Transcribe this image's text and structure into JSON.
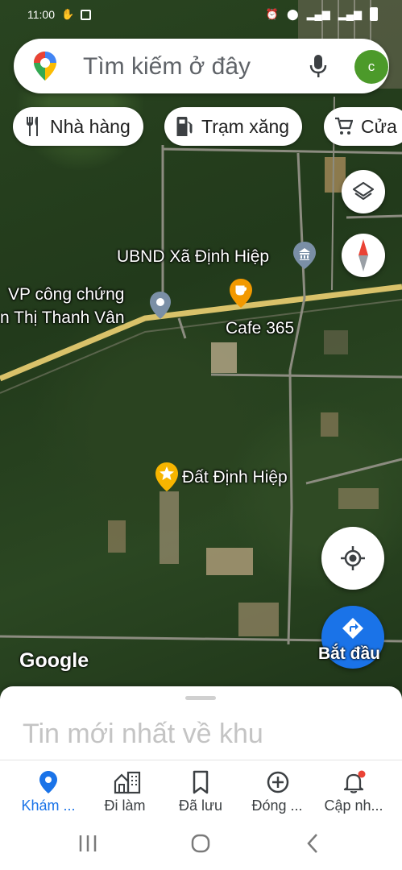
{
  "status_bar": {
    "time": "11:00"
  },
  "search": {
    "placeholder": "Tìm kiếm ở đây",
    "avatar_letter": "c"
  },
  "chips": [
    {
      "label": "Nhà hàng",
      "icon": "restaurant-icon"
    },
    {
      "label": "Trạm xăng",
      "icon": "gas-station-icon"
    },
    {
      "label": "Cửa",
      "icon": "shopping-cart-icon"
    }
  ],
  "map": {
    "labels": {
      "ubnd": "UBND Xã Định Hiệp",
      "vp_line1": "VP công chứng",
      "vp_line2": "n Thị Thanh Vân",
      "cafe": "Cafe 365",
      "dat": "Đất Định Hiệp"
    },
    "google": "Google",
    "start_label": "Bắt đầu"
  },
  "sheet": {
    "title": "Tin mới nhất về khu"
  },
  "bottom_nav": [
    {
      "label": "Khám ...",
      "icon": "explore-pin-icon",
      "active": true
    },
    {
      "label": "Đi làm",
      "icon": "commute-icon",
      "active": false
    },
    {
      "label": "Đã lưu",
      "icon": "bookmark-icon",
      "active": false
    },
    {
      "label": "Đóng ...",
      "icon": "add-circle-icon",
      "active": false
    },
    {
      "label": "Cập nh...",
      "icon": "notification-bell-icon",
      "active": false
    }
  ],
  "colors": {
    "accent": "#1a73e8",
    "avatar": "#4c9a2a",
    "road": "#d9c26a",
    "cafe_pin": "#f29900"
  }
}
